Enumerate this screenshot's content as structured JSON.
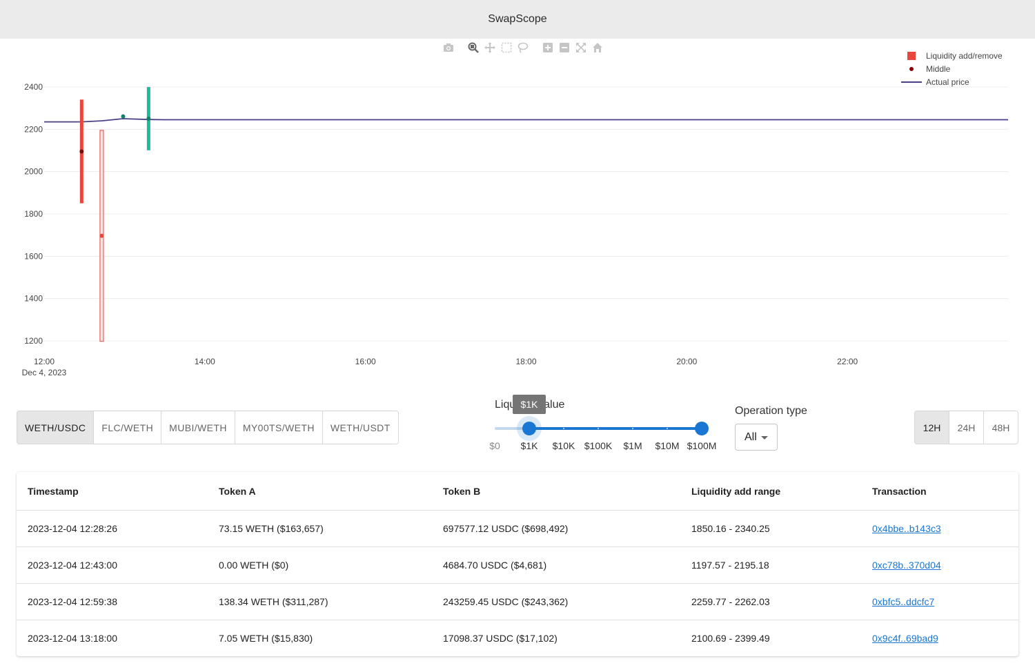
{
  "app": {
    "title": "SwapScope"
  },
  "modebar": [
    {
      "name": "camera-icon",
      "title": "Download plot as a png"
    },
    {
      "name": "zoom-icon",
      "title": "Zoom"
    },
    {
      "name": "pan-icon",
      "title": "Pan"
    },
    {
      "name": "box-select-icon",
      "title": "Box Select"
    },
    {
      "name": "lasso-select-icon",
      "title": "Lasso Select"
    },
    {
      "name": "zoom-in-icon",
      "title": "Zoom in"
    },
    {
      "name": "zoom-out-icon",
      "title": "Zoom out"
    },
    {
      "name": "autoscale-icon",
      "title": "Autoscale"
    },
    {
      "name": "reset-axes-icon",
      "title": "Reset axes"
    }
  ],
  "chart_data": {
    "type": "line",
    "title": "",
    "xlabel": "",
    "ylabel": "",
    "x_range": [
      "2023-12-04 12:00",
      "2023-12-05 00:00"
    ],
    "ylim": [
      1200,
      2400
    ],
    "x_ticks": [
      "12:00",
      "14:00",
      "16:00",
      "18:00",
      "20:00",
      "22:00"
    ],
    "x_tick_sublabel": "Dec 4, 2023",
    "y_ticks": [
      1200,
      1400,
      1600,
      1800,
      2000,
      2200,
      2400
    ],
    "grid": true,
    "legend_position": "top-right",
    "legend": [
      "Liquidity add/remove",
      "Middle",
      "Actual price"
    ],
    "series": [
      {
        "name": "Actual price",
        "mode": "line",
        "color": "#4a3f87",
        "points": [
          {
            "x": "2023-12-04 12:00",
            "y": 2235
          },
          {
            "x": "2023-12-04 12:28",
            "y": 2235
          },
          {
            "x": "2023-12-04 12:43",
            "y": 2240
          },
          {
            "x": "2023-12-04 12:59",
            "y": 2250
          },
          {
            "x": "2023-12-04 13:18",
            "y": 2246
          },
          {
            "x": "2023-12-04 13:30",
            "y": 2245
          },
          {
            "x": "2023-12-05 00:00",
            "y": 2245
          }
        ]
      },
      {
        "name": "Liquidity add/remove",
        "mode": "range",
        "ranges": [
          {
            "x": "2023-12-04 12:28",
            "low": 1850.16,
            "high": 2340.25,
            "middle": 2095.2,
            "color": "#e8463c",
            "filled": true
          },
          {
            "x": "2023-12-04 12:43",
            "low": 1197.57,
            "high": 2195.18,
            "middle": 1696.4,
            "color": "#e8463c",
            "filled": false
          },
          {
            "x": "2023-12-04 12:59",
            "low": 2259.77,
            "high": 2262.03,
            "middle": 2260.9,
            "color": "#1fb89a",
            "filled": true
          },
          {
            "x": "2023-12-04 13:18",
            "low": 2100.69,
            "high": 2399.49,
            "middle": 2250.1,
            "color": "#1fb89a",
            "filled": true
          }
        ]
      }
    ]
  },
  "legend": [
    {
      "label": "Liquidity add/remove",
      "symbol": "square",
      "color": "#e8463c"
    },
    {
      "label": "Middle",
      "symbol": "dot",
      "color": "#8b0000"
    },
    {
      "label": "Actual price",
      "symbol": "line",
      "color": "#4a3f87"
    }
  ],
  "pairs": {
    "selected": "WETH/USDC",
    "items": [
      "WETH/USDC",
      "FLC/WETH",
      "MUBI/WETH",
      "MY00TS/WETH",
      "WETH/USDT"
    ]
  },
  "slider": {
    "label": "Liquidity value",
    "tooltip": "$1K",
    "marks": [
      "$0",
      "$1K",
      "$10K",
      "$100K",
      "$1M",
      "$10M",
      "$100M"
    ],
    "selected_range": [
      1,
      6
    ]
  },
  "operation": {
    "label": "Operation type",
    "value": "All"
  },
  "time_range": {
    "selected": "12H",
    "items": [
      "12H",
      "24H",
      "48H"
    ]
  },
  "table": {
    "headers": [
      "Timestamp",
      "Token A",
      "Token B",
      "Liquidity add range",
      "Transaction"
    ],
    "rows": [
      [
        "2023-12-04 12:28:26",
        "73.15 WETH ($163,657)",
        "697577.12 USDC ($698,492)",
        "1850.16 - 2340.25",
        "0x4bbe..b143c3"
      ],
      [
        "2023-12-04 12:43:00",
        "0.00 WETH ($0)",
        "4684.70 USDC ($4,681)",
        "1197.57 - 2195.18",
        "0xc78b..370d04"
      ],
      [
        "2023-12-04 12:59:38",
        "138.34 WETH ($311,287)",
        "243259.45 USDC ($243,362)",
        "2259.77 - 2262.03",
        "0xbfc5..ddcfc7"
      ],
      [
        "2023-12-04 13:18:00",
        "7.05 WETH ($15,830)",
        "17098.37 USDC ($17,102)",
        "2100.69 - 2399.49",
        "0x9c4f..69bad9"
      ]
    ]
  }
}
